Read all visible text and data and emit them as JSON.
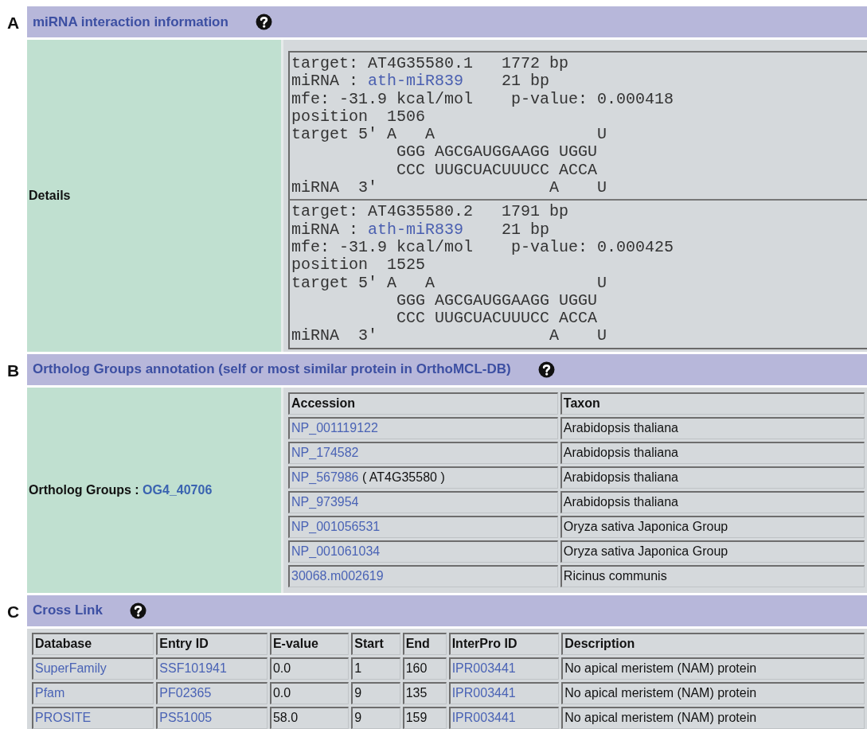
{
  "sections": [
    {
      "letter": "A",
      "kind": "details",
      "title": "miRNA interaction information",
      "label": "Details",
      "alignments": [
        {
          "target": "target: AT4G35580.1   1772 bp",
          "mirna_prefix": "miRNA : ",
          "mirna_link": "ath-miR839",
          "mirna_suffix": "    21 bp",
          "mfe": "mfe: -31.9 kcal/mol    p-value: 0.000418",
          "position": "position  1506",
          "pairing": [
            "target 5' A   A                 U",
            "           GGG AGCGAUGGAAGG UGGU",
            "           CCC UUGCUACUUUCC ACCA",
            "miRNA  3'                  A    U"
          ]
        },
        {
          "target": "target: AT4G35580.2   1791 bp",
          "mirna_prefix": "miRNA : ",
          "mirna_link": "ath-miR839",
          "mirna_suffix": "    21 bp",
          "mfe": "mfe: -31.9 kcal/mol    p-value: 0.000425",
          "position": "position  1525",
          "pairing": [
            "target 5' A   A                 U",
            "           GGG AGCGAUGGAAGG UGGU",
            "           CCC UUGCUACUUUCC ACCA",
            "miRNA  3'                  A    U"
          ]
        }
      ]
    },
    {
      "letter": "B",
      "kind": "orthologs",
      "title": "Ortholog Groups annotation (self or most similar protein in OrthoMCL-DB)",
      "label": "Ortholog Groups : ",
      "group_link": "OG4_40706",
      "columns": [
        "Accession",
        "Taxon"
      ],
      "rows": [
        {
          "accession": "NP_001119122",
          "taxon": "Arabidopsis thaliana"
        },
        {
          "accession": "NP_174582",
          "taxon": "Arabidopsis thaliana"
        },
        {
          "accession": "NP_567986",
          "note": "( AT4G35580 )",
          "taxon": "Arabidopsis thaliana"
        },
        {
          "accession": "NP_973954",
          "taxon": "Arabidopsis thaliana"
        },
        {
          "accession": "NP_001056531",
          "taxon": "Oryza sativa Japonica Group"
        },
        {
          "accession": "NP_001061034",
          "taxon": "Oryza sativa Japonica Group"
        },
        {
          "accession": "30068.m002619",
          "taxon": "Ricinus communis"
        }
      ]
    },
    {
      "letter": "C",
      "kind": "crosslink",
      "title": "Cross Link",
      "columns": [
        {
          "label": "Database",
          "link": true
        },
        {
          "label": "Entry ID",
          "link": true
        },
        {
          "label": "E-value",
          "link": false
        },
        {
          "label": "Start",
          "link": false
        },
        {
          "label": "End",
          "link": false
        },
        {
          "label": "InterPro ID",
          "link": true
        },
        {
          "label": "Description",
          "link": false
        }
      ],
      "rows": [
        [
          "SuperFamily",
          "SSF101941",
          "0.0",
          "1",
          "160",
          "IPR003441",
          "No apical meristem (NAM) protein"
        ],
        [
          "Pfam",
          "PF02365",
          "0.0",
          "9",
          "135",
          "IPR003441",
          "No apical meristem (NAM) protein"
        ],
        [
          "PROSITE",
          "PS51005",
          "58.0",
          "9",
          "159",
          "IPR003441",
          "No apical meristem (NAM) protein"
        ]
      ]
    }
  ]
}
